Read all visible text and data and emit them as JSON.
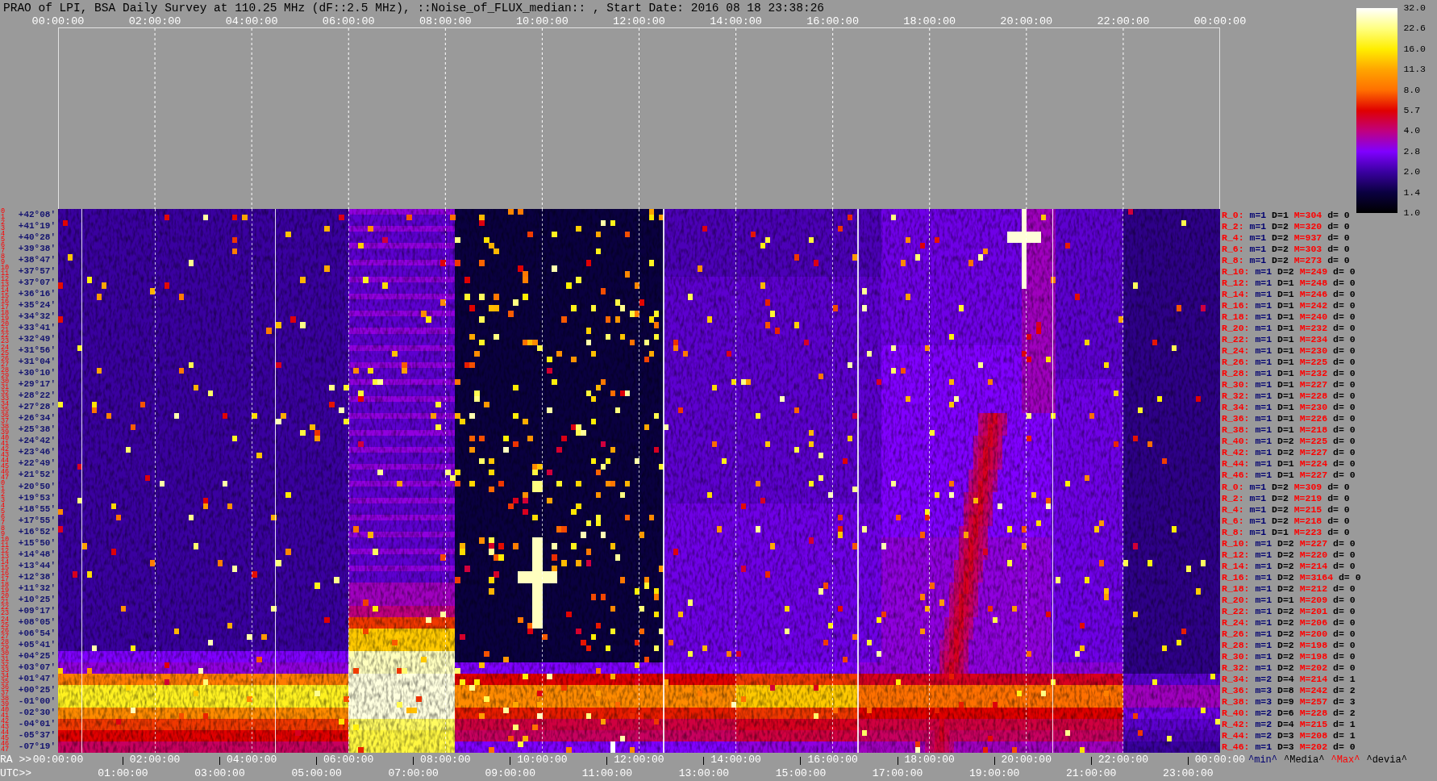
{
  "title": "PRAO of LPI, BSA Daily Survey at 110.25 MHz (dF::2.5 MHz), ::Noise_of_FLUX_median:: , Start Date: 2016 08 18 23:38:26",
  "top_axis": {
    "ticks": [
      "00:00:00",
      "02:00:00",
      "04:00:00",
      "06:00:00",
      "08:00:00",
      "10:00:00",
      "12:00:00",
      "14:00:00",
      "16:00:00",
      "18:00:00",
      "20:00:00",
      "22:00:00",
      "00:00:00"
    ]
  },
  "colorbar": {
    "labels": [
      "32.0",
      "22.6",
      "16.0",
      "11.3",
      "8.0",
      "5.7",
      "4.0",
      "2.8",
      "2.0",
      "1.4",
      "1.0"
    ]
  },
  "rows": [
    {
      "numbers": [
        "0",
        "1"
      ],
      "declination": "+42°08'",
      "label": "R_0:",
      "min": "m=1",
      "median": "D=1",
      "max": "M=304",
      "deviation": "d= 0"
    },
    {
      "numbers": [
        "2",
        "3"
      ],
      "declination": "+41°19'",
      "label": "R_2:",
      "min": "m=1",
      "median": "D=2",
      "max": "M=320",
      "deviation": "d= 0"
    },
    {
      "numbers": [
        "4",
        "5"
      ],
      "declination": "+40°28'",
      "label": "R_4:",
      "min": "m=1",
      "median": "D=2",
      "max": "M=937",
      "deviation": "d= 0"
    },
    {
      "numbers": [
        "6",
        "7"
      ],
      "declination": "+39°38'",
      "label": "R_6:",
      "min": "m=1",
      "median": "D=2",
      "max": "M=303",
      "deviation": "d= 0"
    },
    {
      "numbers": [
        "8",
        "9"
      ],
      "declination": "+38°47'",
      "label": "R_8:",
      "min": "m=1",
      "median": "D=2",
      "max": "M=273",
      "deviation": "d= 0"
    },
    {
      "numbers": [
        "10",
        "11"
      ],
      "declination": "+37°57'",
      "label": "R_10:",
      "min": "m=1",
      "median": "D=2",
      "max": "M=249",
      "deviation": "d= 0"
    },
    {
      "numbers": [
        "12",
        "13"
      ],
      "declination": "+37°07'",
      "label": "R_12:",
      "min": "m=1",
      "median": "D=1",
      "max": "M=248",
      "deviation": "d= 0"
    },
    {
      "numbers": [
        "14",
        "15"
      ],
      "declination": "+36°16'",
      "label": "R_14:",
      "min": "m=1",
      "median": "D=1",
      "max": "M=246",
      "deviation": "d= 0"
    },
    {
      "numbers": [
        "16",
        "17"
      ],
      "declination": "+35°24'",
      "label": "R_16:",
      "min": "m=1",
      "median": "D=1",
      "max": "M=242",
      "deviation": "d= 0"
    },
    {
      "numbers": [
        "18",
        "19"
      ],
      "declination": "+34°32'",
      "label": "R_18:",
      "min": "m=1",
      "median": "D=1",
      "max": "M=240",
      "deviation": "d= 0"
    },
    {
      "numbers": [
        "20",
        "21"
      ],
      "declination": "+33°41'",
      "label": "R_20:",
      "min": "m=1",
      "median": "D=1",
      "max": "M=232",
      "deviation": "d= 0"
    },
    {
      "numbers": [
        "22",
        "23"
      ],
      "declination": "+32°49'",
      "label": "R_22:",
      "min": "m=1",
      "median": "D=1",
      "max": "M=234",
      "deviation": "d= 0"
    },
    {
      "numbers": [
        "24",
        "25"
      ],
      "declination": "+31°56'",
      "label": "R_24:",
      "min": "m=1",
      "median": "D=1",
      "max": "M=230",
      "deviation": "d= 0"
    },
    {
      "numbers": [
        "26",
        "27"
      ],
      "declination": "+31°04'",
      "label": "R_26:",
      "min": "m=1",
      "median": "D=1",
      "max": "M=225",
      "deviation": "d= 0"
    },
    {
      "numbers": [
        "28",
        "29"
      ],
      "declination": "+30°10'",
      "label": "R_28:",
      "min": "m=1",
      "median": "D=1",
      "max": "M=232",
      "deviation": "d= 0"
    },
    {
      "numbers": [
        "30",
        "31"
      ],
      "declination": "+29°17'",
      "label": "R_30:",
      "min": "m=1",
      "median": "D=1",
      "max": "M=227",
      "deviation": "d= 0"
    },
    {
      "numbers": [
        "32",
        "33"
      ],
      "declination": "+28°22'",
      "label": "R_32:",
      "min": "m=1",
      "median": "D=1",
      "max": "M=228",
      "deviation": "d= 0"
    },
    {
      "numbers": [
        "34",
        "35"
      ],
      "declination": "+27°28'",
      "label": "R_34:",
      "min": "m=1",
      "median": "D=1",
      "max": "M=230",
      "deviation": "d= 0"
    },
    {
      "numbers": [
        "36",
        "37"
      ],
      "declination": "+26°34'",
      "label": "R_36:",
      "min": "m=1",
      "median": "D=1",
      "max": "M=226",
      "deviation": "d= 0"
    },
    {
      "numbers": [
        "38",
        "39"
      ],
      "declination": "+25°38'",
      "label": "R_38:",
      "min": "m=1",
      "median": "D=1",
      "max": "M=218",
      "deviation": "d= 0"
    },
    {
      "numbers": [
        "40",
        "41"
      ],
      "declination": "+24°42'",
      "label": "R_40:",
      "min": "m=1",
      "median": "D=2",
      "max": "M=225",
      "deviation": "d= 0"
    },
    {
      "numbers": [
        "42",
        "43"
      ],
      "declination": "+23°46'",
      "label": "R_42:",
      "min": "m=1",
      "median": "D=2",
      "max": "M=227",
      "deviation": "d= 0"
    },
    {
      "numbers": [
        "44",
        "45"
      ],
      "declination": "+22°49'",
      "label": "R_44:",
      "min": "m=1",
      "median": "D=1",
      "max": "M=224",
      "deviation": "d= 0"
    },
    {
      "numbers": [
        "46",
        "47"
      ],
      "declination": "+21°52'",
      "label": "R_46:",
      "min": "m=1",
      "median": "D=1",
      "max": "M=227",
      "deviation": "d= 0"
    },
    {
      "numbers": [
        "0",
        "1"
      ],
      "declination": "+20°50'",
      "label": "R_0:",
      "min": "m=1",
      "median": "D=2",
      "max": "M=309",
      "deviation": "d= 0"
    },
    {
      "numbers": [
        "2",
        "3"
      ],
      "declination": "+19°53'",
      "label": "R_2:",
      "min": "m=1",
      "median": "D=2",
      "max": "M=219",
      "deviation": "d= 0"
    },
    {
      "numbers": [
        "4",
        "5"
      ],
      "declination": "+18°55'",
      "label": "R_4:",
      "min": "m=1",
      "median": "D=2",
      "max": "M=215",
      "deviation": "d= 0"
    },
    {
      "numbers": [
        "6",
        "7"
      ],
      "declination": "+17°55'",
      "label": "R_6:",
      "min": "m=1",
      "median": "D=2",
      "max": "M=218",
      "deviation": "d= 0"
    },
    {
      "numbers": [
        "8",
        "9"
      ],
      "declination": "+16°52'",
      "label": "R_8:",
      "min": "m=1",
      "median": "D=1",
      "max": "M=223",
      "deviation": "d= 0"
    },
    {
      "numbers": [
        "10",
        "11"
      ],
      "declination": "+15°50'",
      "label": "R_10:",
      "min": "m=1",
      "median": "D=2",
      "max": "M=227",
      "deviation": "d= 0"
    },
    {
      "numbers": [
        "12",
        "13"
      ],
      "declination": "+14°48'",
      "label": "R_12:",
      "min": "m=1",
      "median": "D=2",
      "max": "M=220",
      "deviation": "d= 0"
    },
    {
      "numbers": [
        "14",
        "15"
      ],
      "declination": "+13°44'",
      "label": "R_14:",
      "min": "m=1",
      "median": "D=2",
      "max": "M=214",
      "deviation": "d= 0"
    },
    {
      "numbers": [
        "16",
        "17"
      ],
      "declination": "+12°38'",
      "label": "R_16:",
      "min": "m=1",
      "median": "D=2",
      "max": "M=3164",
      "deviation": "d= 0"
    },
    {
      "numbers": [
        "18",
        "19"
      ],
      "declination": "+11°32'",
      "label": "R_18:",
      "min": "m=1",
      "median": "D=2",
      "max": "M=212",
      "deviation": "d= 0"
    },
    {
      "numbers": [
        "20",
        "21"
      ],
      "declination": "+10°25'",
      "label": "R_20:",
      "min": "m=1",
      "median": "D=1",
      "max": "M=209",
      "deviation": "d= 0"
    },
    {
      "numbers": [
        "22",
        "23"
      ],
      "declination": "+09°17'",
      "label": "R_22:",
      "min": "m=1",
      "median": "D=2",
      "max": "M=201",
      "deviation": "d= 0"
    },
    {
      "numbers": [
        "24",
        "25"
      ],
      "declination": "+08°05'",
      "label": "R_24:",
      "min": "m=1",
      "median": "D=2",
      "max": "M=206",
      "deviation": "d= 0"
    },
    {
      "numbers": [
        "26",
        "27"
      ],
      "declination": "+06°54'",
      "label": "R_26:",
      "min": "m=1",
      "median": "D=2",
      "max": "M=200",
      "deviation": "d= 0"
    },
    {
      "numbers": [
        "28",
        "29"
      ],
      "declination": "+05°41'",
      "label": "R_28:",
      "min": "m=1",
      "median": "D=2",
      "max": "M=198",
      "deviation": "d= 0"
    },
    {
      "numbers": [
        "30",
        "31"
      ],
      "declination": "+04°25'",
      "label": "R_30:",
      "min": "m=1",
      "median": "D=2",
      "max": "M=198",
      "deviation": "d= 0"
    },
    {
      "numbers": [
        "32",
        "33"
      ],
      "declination": "+03°07'",
      "label": "R_32:",
      "min": "m=1",
      "median": "D=2",
      "max": "M=202",
      "deviation": "d= 0"
    },
    {
      "numbers": [
        "34",
        "35"
      ],
      "declination": "+01°47'",
      "label": "R_34:",
      "min": "m=2",
      "median": "D=4",
      "max": "M=214",
      "deviation": "d= 1"
    },
    {
      "numbers": [
        "36",
        "37"
      ],
      "declination": "+00°25'",
      "label": "R_36:",
      "min": "m=3",
      "median": "D=8",
      "max": "M=242",
      "deviation": "d= 2"
    },
    {
      "numbers": [
        "38",
        "39"
      ],
      "declination": "-01°00'",
      "label": "R_38:",
      "min": "m=3",
      "median": "D=9",
      "max": "M=257",
      "deviation": "d= 3"
    },
    {
      "numbers": [
        "40",
        "41"
      ],
      "declination": "-02°30'",
      "label": "R_40:",
      "min": "m=2",
      "median": "D=6",
      "max": "M=228",
      "deviation": "d= 2"
    },
    {
      "numbers": [
        "42",
        "43"
      ],
      "declination": "-04°01'",
      "label": "R_42:",
      "min": "m=2",
      "median": "D=4",
      "max": "M=215",
      "deviation": "d= 1"
    },
    {
      "numbers": [
        "44",
        "45"
      ],
      "declination": "-05°37'",
      "label": "R_44:",
      "min": "m=2",
      "median": "D=3",
      "max": "M=208",
      "deviation": "d= 1"
    },
    {
      "numbers": [
        "46",
        "47"
      ],
      "declination": "-07°19'",
      "label": "R_46:",
      "min": "m=1",
      "median": "D=3",
      "max": "M=202",
      "deviation": "d= 0"
    }
  ],
  "ra_axis": {
    "title": "RA >>",
    "ticks": [
      "00:00:00",
      "02:00:00",
      "04:00:00",
      "06:00:00",
      "08:00:00",
      "10:00:00",
      "12:00:00",
      "14:00:00",
      "16:00:00",
      "18:00:00",
      "20:00:00",
      "22:00:00",
      "00:00:00"
    ]
  },
  "legend": [
    {
      "kind": "min",
      "text": "^min^"
    },
    {
      "kind": "median",
      "text": "^Media^"
    },
    {
      "kind": "max",
      "text": "^Max^"
    },
    {
      "kind": "deviation",
      "text": "^devia^"
    }
  ],
  "utc_axis": {
    "title": "UTC>>",
    "ticks": [
      "01:00:00",
      "03:00:00",
      "05:00:00",
      "07:00:00",
      "09:00:00",
      "11:00:00",
      "13:00:00",
      "15:00:00",
      "17:00:00",
      "19:00:00",
      "21:00:00",
      "23:00:00"
    ]
  }
}
